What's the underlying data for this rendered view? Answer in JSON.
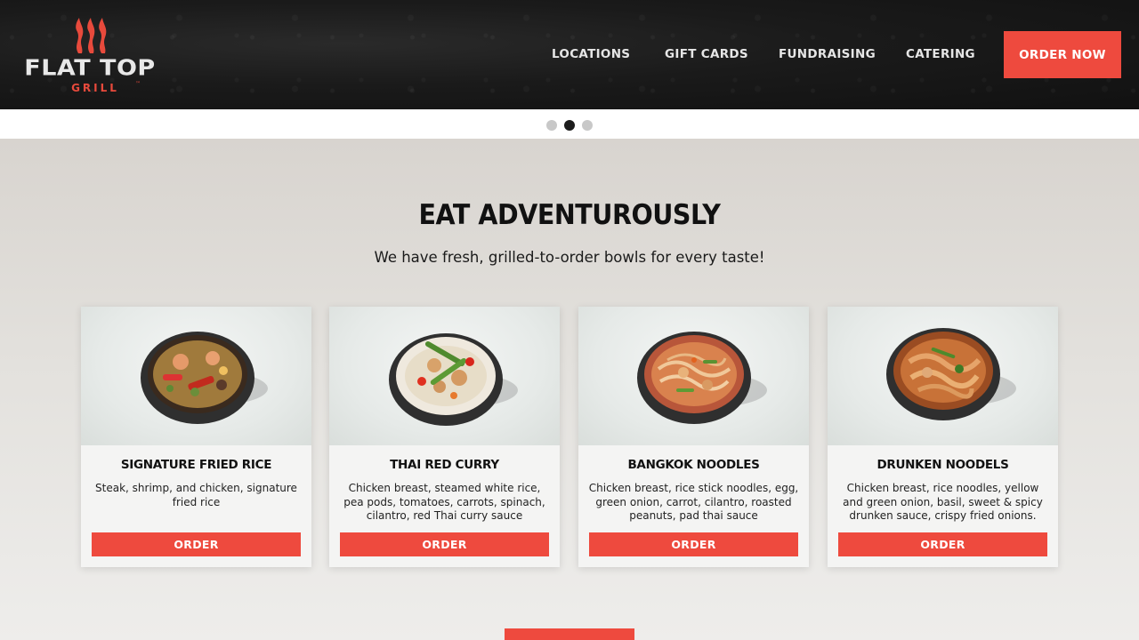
{
  "brand": {
    "name": "FLAT TOP",
    "sub": "GRILL",
    "trademark": "™",
    "accent_color": "#ee4a3e"
  },
  "nav": {
    "items": [
      {
        "label": "LOCATIONS"
      },
      {
        "label": "GIFT CARDS"
      },
      {
        "label": "FUNDRAISING"
      },
      {
        "label": "CATERING"
      }
    ],
    "cta_label": "ORDER NOW"
  },
  "slider": {
    "slide_count": 3,
    "active_slide": 2
  },
  "section": {
    "title": "EAT ADVENTUROUSLY",
    "subtitle": "We have fresh, grilled-to-order bowls for every taste!"
  },
  "bowls": [
    {
      "name": "SIGNATURE FRIED RICE",
      "description": "Steak, shrimp, and chicken, signature fried rice",
      "button_label": "ORDER",
      "image_icon": "fried-rice-bowl"
    },
    {
      "name": "THAI RED CURRY",
      "description": "Chicken breast, steamed white rice, pea pods, tomatoes, carrots, spinach, cilantro, red Thai curry sauce",
      "button_label": "ORDER",
      "image_icon": "curry-bowl"
    },
    {
      "name": "BANGKOK NOODLES",
      "description": "Chicken breast, rice stick noodles, egg, green onion, carrot, cilantro, roasted peanuts, pad thai sauce",
      "button_label": "ORDER",
      "image_icon": "noodle-bowl"
    },
    {
      "name": "DRUNKEN NOODELS",
      "description": "Chicken breast, rice noodles, yellow and green onion, basil, sweet & spicy drunken sauce, crispy fried onions.",
      "button_label": "ORDER",
      "image_icon": "noodle-bowl"
    }
  ]
}
